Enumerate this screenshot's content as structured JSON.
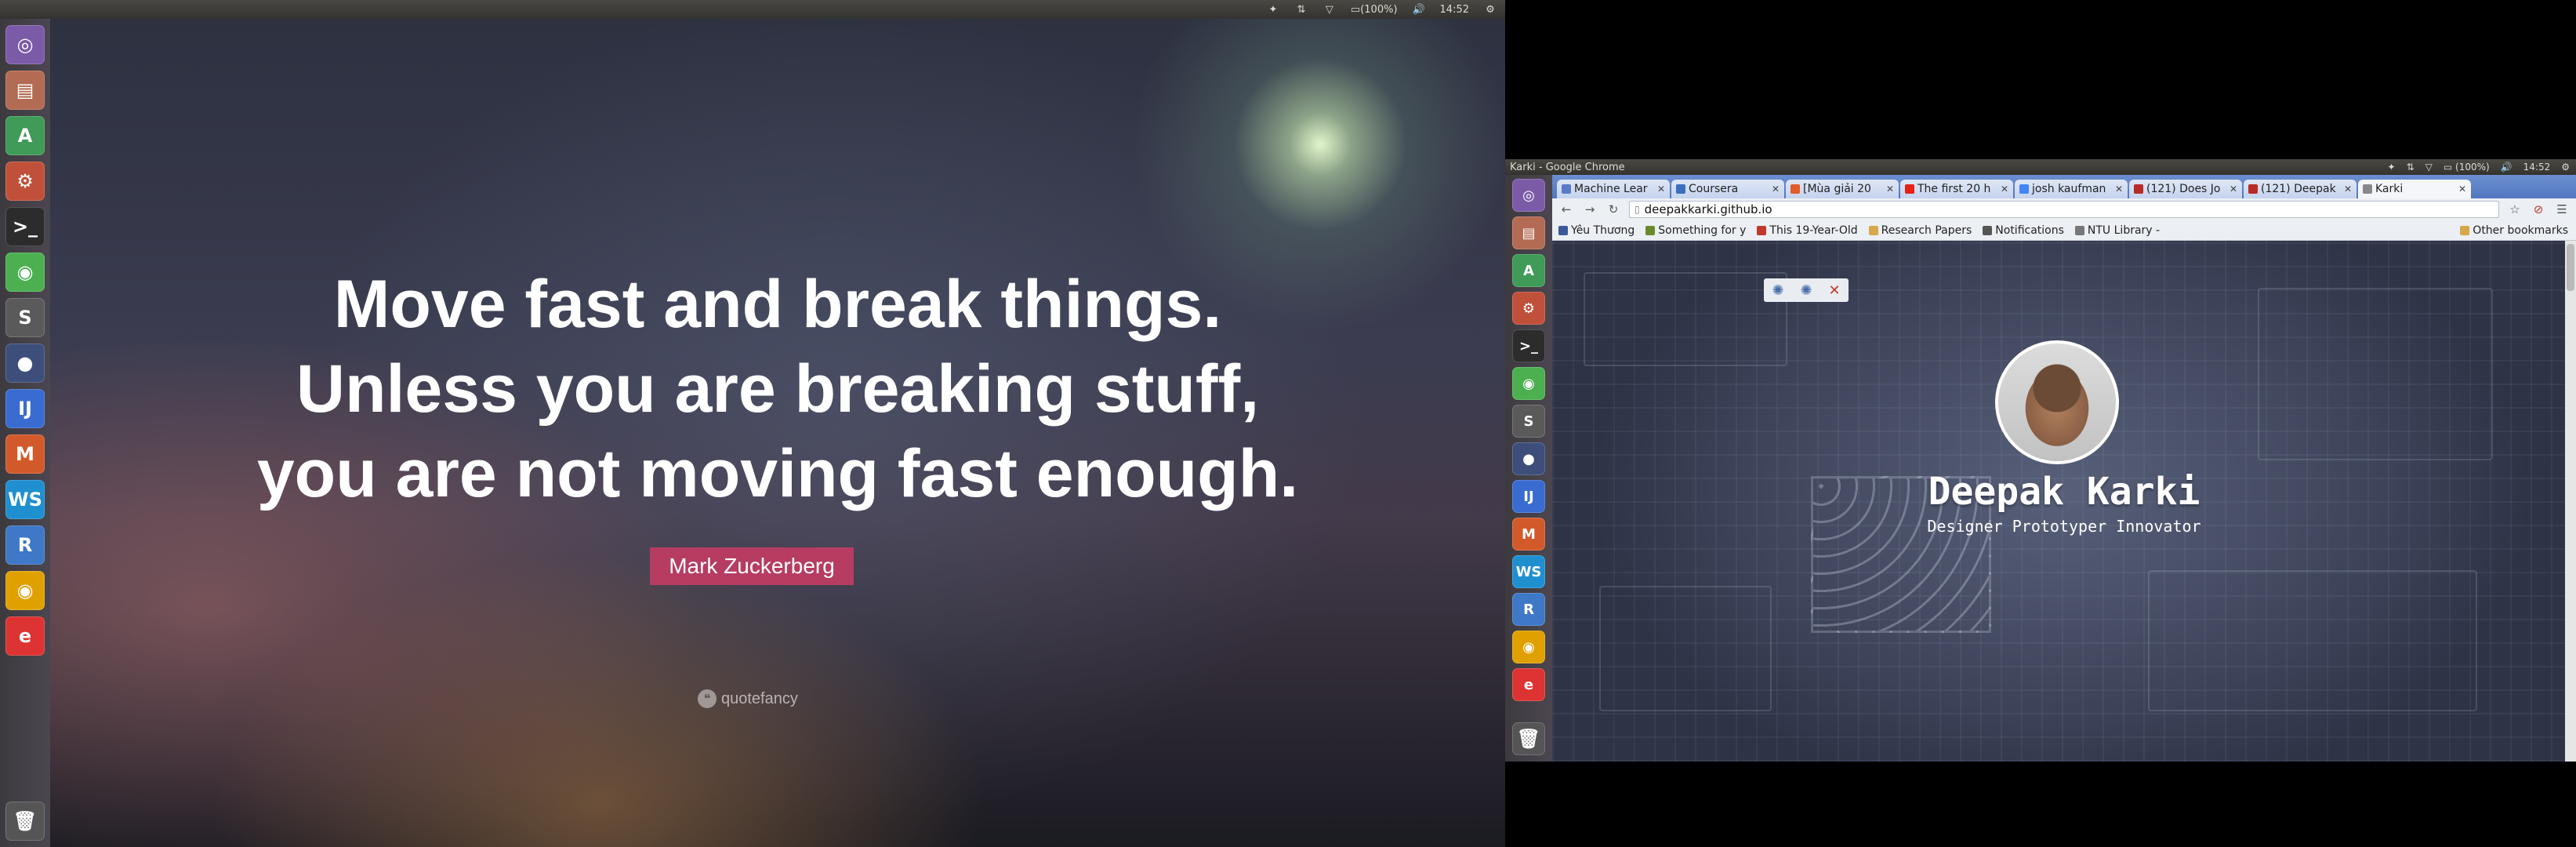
{
  "panel_left": {
    "battery": "(100%)",
    "clock": "14:52",
    "indicators": [
      "dropbox-icon",
      "network-icon",
      "vpn-icon",
      "battery-icon",
      "volume-icon",
      "settings-icon"
    ]
  },
  "launcher_items": [
    {
      "name": "ubuntu-dash",
      "glyph": "◎",
      "color": "#7b5ba8"
    },
    {
      "name": "files",
      "glyph": "▤",
      "color": "#b46b53"
    },
    {
      "name": "android-studio",
      "glyph": "A",
      "color": "#3f9b57"
    },
    {
      "name": "system-settings",
      "glyph": "⚙",
      "color": "#c0503a"
    },
    {
      "name": "terminal",
      "glyph": ">_",
      "color": "#2c2c2c"
    },
    {
      "name": "chrome",
      "glyph": "◉",
      "color": "#4caf50"
    },
    {
      "name": "sublime-text",
      "glyph": "S",
      "color": "#5a5a5a"
    },
    {
      "name": "screen-recorder",
      "glyph": "●",
      "color": "#3d4e7a"
    },
    {
      "name": "intellij",
      "glyph": "IJ",
      "color": "#3a6bd1"
    },
    {
      "name": "matlab",
      "glyph": "M",
      "color": "#d25a2a"
    },
    {
      "name": "webstorm",
      "glyph": "WS",
      "color": "#1f8fd0"
    },
    {
      "name": "rstudio",
      "glyph": "R",
      "color": "#3e78c6"
    },
    {
      "name": "chrome-2",
      "glyph": "◉",
      "color": "#e0a100"
    },
    {
      "name": "text-editor",
      "glyph": "e",
      "color": "#d33"
    }
  ],
  "trash": {
    "name": "trash",
    "glyph": "🗑"
  },
  "quote": {
    "line1": "Move fast and break things.",
    "line2": "Unless you are breaking stuff,",
    "line3": "you are not moving fast enough.",
    "author": "Mark Zuckerberg",
    "brand": "quotefancy"
  },
  "browser": {
    "window_title": "Karki - Google Chrome",
    "clock": "14:52",
    "battery": "(100%)",
    "tabs": [
      {
        "label": "Machine Lear",
        "color": "#5b7bc8"
      },
      {
        "label": "Coursera",
        "color": "#3b6fc0"
      },
      {
        "label": "[Mùa giải 20",
        "color": "#e25b2a"
      },
      {
        "label": "The first 20 h",
        "color": "#e62117"
      },
      {
        "label": "josh kaufman",
        "color": "#4285f4"
      },
      {
        "label": "(121) Does Jo",
        "color": "#b92b27"
      },
      {
        "label": "(121) Deepak",
        "color": "#b92b27"
      },
      {
        "label": "Karki",
        "color": "#888888",
        "active": true
      }
    ],
    "url": "deepakkarki.github.io",
    "bookmarks": [
      {
        "label": "Yêu Thương",
        "color": "#3b5998"
      },
      {
        "label": "Something for y",
        "color": "#6a8b2a"
      },
      {
        "label": "This 19-Year-Old",
        "color": "#c0392b"
      },
      {
        "label": "Research Papers",
        "color": "#d6a84b"
      },
      {
        "label": "Notifications",
        "color": "#555555"
      },
      {
        "label": "NTU Library - ",
        "color": "#777777"
      }
    ],
    "other_bookmarks": "Other bookmarks",
    "page": {
      "name": "Deepak Karki",
      "tagline": "Designer Prototyper Innovator"
    }
  }
}
